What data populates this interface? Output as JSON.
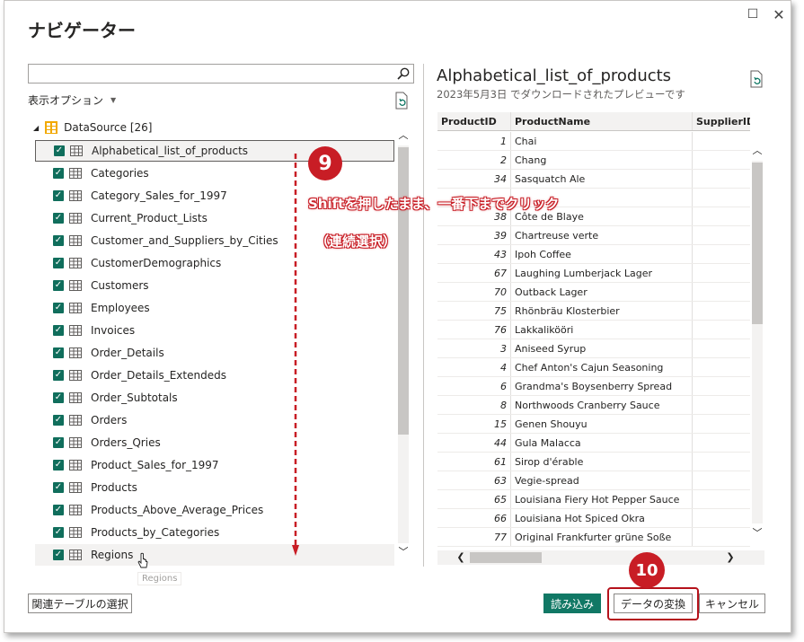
{
  "window": {
    "title": "ナビゲーター",
    "maximize_icon": "☐",
    "close_icon": "✕"
  },
  "left_pane": {
    "search": {
      "value": "",
      "placeholder": ""
    },
    "display_options": "表示オプション",
    "datasource": {
      "label": "DataSource [26]"
    },
    "items": [
      {
        "label": "Alphabetical_list_of_products",
        "checked": true,
        "selected": true
      },
      {
        "label": "Categories",
        "checked": true
      },
      {
        "label": "Category_Sales_for_1997",
        "checked": true
      },
      {
        "label": "Current_Product_Lists",
        "checked": true
      },
      {
        "label": "Customer_and_Suppliers_by_Cities",
        "checked": true
      },
      {
        "label": "CustomerDemographics",
        "checked": true
      },
      {
        "label": "Customers",
        "checked": true
      },
      {
        "label": "Employees",
        "checked": true
      },
      {
        "label": "Invoices",
        "checked": true
      },
      {
        "label": "Order_Details",
        "checked": true
      },
      {
        "label": "Order_Details_Extendeds",
        "checked": true
      },
      {
        "label": "Order_Subtotals",
        "checked": true
      },
      {
        "label": "Orders",
        "checked": true
      },
      {
        "label": "Orders_Qries",
        "checked": true
      },
      {
        "label": "Product_Sales_for_1997",
        "checked": true
      },
      {
        "label": "Products",
        "checked": true
      },
      {
        "label": "Products_Above_Average_Prices",
        "checked": true
      },
      {
        "label": "Products_by_Categories",
        "checked": true
      },
      {
        "label": "Regions",
        "checked": true,
        "hover": true
      }
    ],
    "tooltip": "Regions"
  },
  "preview": {
    "title": "Alphabetical_list_of_products",
    "subtitle": "2023年5月3日 でダウンロードされたプレビューです",
    "columns": [
      "ProductID",
      "ProductName",
      "SupplierID"
    ],
    "rows": [
      [
        "1",
        "Chai",
        ""
      ],
      [
        "2",
        "Chang",
        ""
      ],
      [
        "34",
        "Sasquatch Ale",
        ""
      ],
      [
        "",
        "",
        ""
      ],
      [
        "38",
        "Côte de Blaye",
        ""
      ],
      [
        "39",
        "Chartreuse verte",
        ""
      ],
      [
        "43",
        "Ipoh Coffee",
        ""
      ],
      [
        "67",
        "Laughing Lumberjack Lager",
        ""
      ],
      [
        "70",
        "Outback Lager",
        ""
      ],
      [
        "75",
        "Rhönbräu Klosterbier",
        ""
      ],
      [
        "76",
        "Lakkalikööri",
        ""
      ],
      [
        "3",
        "Aniseed Syrup",
        ""
      ],
      [
        "4",
        "Chef Anton's Cajun Seasoning",
        ""
      ],
      [
        "6",
        "Grandma's Boysenberry Spread",
        ""
      ],
      [
        "8",
        "Northwoods Cranberry Sauce",
        ""
      ],
      [
        "15",
        "Genen Shouyu",
        ""
      ],
      [
        "44",
        "Gula Malacca",
        ""
      ],
      [
        "61",
        "Sirop d'érable",
        ""
      ],
      [
        "63",
        "Vegie-spread",
        ""
      ],
      [
        "65",
        "Louisiana Fiery Hot Pepper Sauce",
        ""
      ],
      [
        "66",
        "Louisiana Hot Spiced Okra",
        ""
      ],
      [
        "77",
        "Original Frankfurter grüne Soße",
        ""
      ]
    ]
  },
  "buttons": {
    "related_tables": "関連テーブルの選択",
    "load": "読み込み",
    "transform": "データの変換",
    "cancel": "キャンセル"
  },
  "annotations": {
    "step9": "9",
    "step9_text1": "Shiftを押したまま、一番下までクリック",
    "step9_text2": "（連続選択）",
    "step10": "10",
    "accent_color": "#c81d25"
  },
  "colors": {
    "checkbox": "#106e5c",
    "load_button": "#117865"
  }
}
